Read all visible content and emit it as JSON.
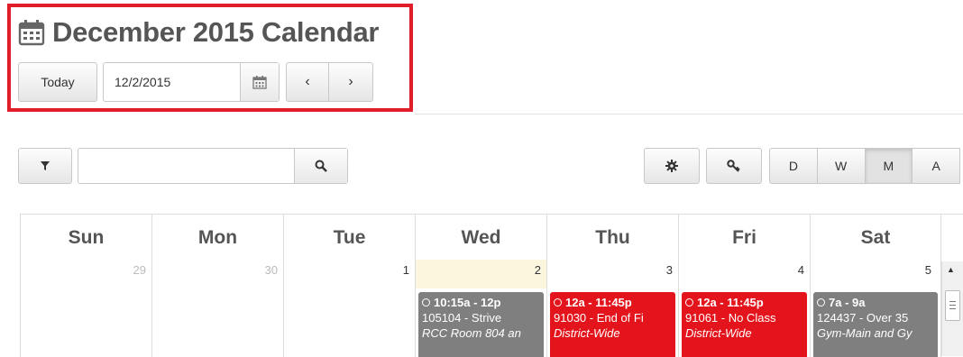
{
  "header": {
    "title": "December 2015 Calendar",
    "today_label": "Today",
    "date_value": "12/2/2015"
  },
  "toolbar": {
    "search_value": "",
    "views": [
      "D",
      "W",
      "M",
      "A"
    ],
    "active_view": "M"
  },
  "calendar": {
    "weekdays": [
      "Sun",
      "Mon",
      "Tue",
      "Wed",
      "Thu",
      "Fri",
      "Sat"
    ],
    "days": [
      {
        "num": "29",
        "other_month": true
      },
      {
        "num": "30",
        "other_month": true
      },
      {
        "num": "1",
        "other_month": false
      },
      {
        "num": "2",
        "other_month": false,
        "today": true
      },
      {
        "num": "3",
        "other_month": false
      },
      {
        "num": "4",
        "other_month": false
      },
      {
        "num": "5",
        "other_month": false
      }
    ],
    "events": [
      {
        "day": 3,
        "time": "10:15a - 12p",
        "name": "105104 - Strive",
        "location": "RCC Room 804 an",
        "color": "#7f7f7f"
      },
      {
        "day": 4,
        "time": "12a - 11:45p",
        "name": "91030 - End of Fi",
        "location": "District-Wide",
        "color": "#e3141b"
      },
      {
        "day": 5,
        "time": "12a - 11:45p",
        "name": "91061 - No Class",
        "location": "District-Wide",
        "color": "#e3141b"
      },
      {
        "day": 6,
        "time": "7a - 9a",
        "name": "124437 - Over 35",
        "location": "Gym-Main and Gy",
        "color": "#7f7f7f"
      }
    ]
  },
  "colors": {
    "highlight": "#e01e2a",
    "today_bg": "#fcf6df"
  }
}
